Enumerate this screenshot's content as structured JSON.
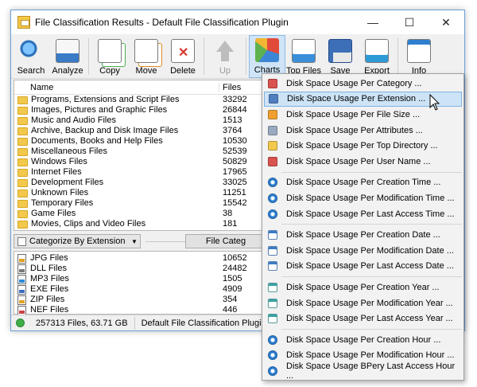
{
  "window": {
    "title": "File Classification Results - Default File Classification Plugin"
  },
  "toolbar": {
    "search": "Search",
    "analyze": "Analyze",
    "copy": "Copy",
    "move": "Move",
    "delete": "Delete",
    "up": "Up",
    "charts": "Charts",
    "top_files": "Top Files",
    "save": "Save",
    "export": "Export",
    "info": "Info"
  },
  "categories": {
    "col_name": "Name",
    "col_files": "Files",
    "rows": [
      {
        "name": "Programs, Extensions and Script Files",
        "files": "33292"
      },
      {
        "name": "Images, Pictures and Graphic Files",
        "files": "26844"
      },
      {
        "name": "Music and Audio Files",
        "files": "1513"
      },
      {
        "name": "Archive, Backup and Disk Image Files",
        "files": "3764"
      },
      {
        "name": "Documents, Books and Help Files",
        "files": "10530"
      },
      {
        "name": "Miscellaneous Files",
        "files": "52539"
      },
      {
        "name": "Windows Files",
        "files": "50829"
      },
      {
        "name": "Internet Files",
        "files": "17965"
      },
      {
        "name": "Development Files",
        "files": "33025"
      },
      {
        "name": "Unknown Files",
        "files": "11251"
      },
      {
        "name": "Temporary Files",
        "files": "15542"
      },
      {
        "name": "Game Files",
        "files": "38"
      },
      {
        "name": "Movies, Clips and Video Files",
        "files": "181"
      }
    ]
  },
  "category_bar": {
    "select_value": "Categorize By Extension",
    "button": "File Categ"
  },
  "extensions": {
    "rows": [
      {
        "name": "JPG Files",
        "files": "10652",
        "color": "#e0a020"
      },
      {
        "name": "DLL Files",
        "files": "24482",
        "color": "#7a7a7a"
      },
      {
        "name": "MP3 Files",
        "files": "1505",
        "color": "#2f8ad8"
      },
      {
        "name": "EXE Files",
        "files": "4909",
        "color": "#3a6fc0"
      },
      {
        "name": "ZIP Files",
        "files": "354",
        "color": "#e2a22a"
      },
      {
        "name": "NEF Files",
        "files": "446",
        "color": "#c44"
      }
    ]
  },
  "status": {
    "summary": "257313 Files, 63.71 GB",
    "plugin": "Default File Classification Plugin"
  },
  "menu": {
    "group1": [
      {
        "label": "Disk Space Usage Per Category ...",
        "icon": "category-icon",
        "color": "#d9534f"
      },
      {
        "label": "Disk Space Usage Per Extension ...",
        "icon": "extension-icon",
        "color": "#4f7fc0"
      },
      {
        "label": "Disk Space Usage Per File Size ...",
        "icon": "filesize-icon",
        "color": "#f0a030"
      },
      {
        "label": "Disk Space Usage Per Attributes ...",
        "icon": "attributes-icon",
        "color": "#9aaac0"
      },
      {
        "label": "Disk Space Usage Per Top Directory ...",
        "icon": "folder-icon",
        "color": "#f2c94c"
      },
      {
        "label": "Disk Space Usage Per User Name ...",
        "icon": "user-icon",
        "color": "#d9534f"
      }
    ],
    "group2": [
      {
        "label": "Disk Space Usage Per Creation Time ..."
      },
      {
        "label": "Disk Space Usage Per Modification Time ..."
      },
      {
        "label": "Disk Space Usage Per Last Access Time ..."
      }
    ],
    "group3": [
      {
        "label": "Disk Space Usage Per Creation Date ..."
      },
      {
        "label": "Disk Space Usage Per Modification Date ..."
      },
      {
        "label": "Disk Space Usage Per Last Access Date ..."
      }
    ],
    "group4": [
      {
        "label": "Disk Space Usage Per Creation Year ..."
      },
      {
        "label": "Disk Space Usage Per Modification Year ..."
      },
      {
        "label": "Disk Space Usage Per Last Access Year ..."
      }
    ],
    "group5": [
      {
        "label": "Disk Space Usage Per Creation Hour ..."
      },
      {
        "label": "Disk Space Usage Per Modification Hour ..."
      },
      {
        "label": "Disk Space Usage BPery Last Access Hour ..."
      }
    ]
  }
}
